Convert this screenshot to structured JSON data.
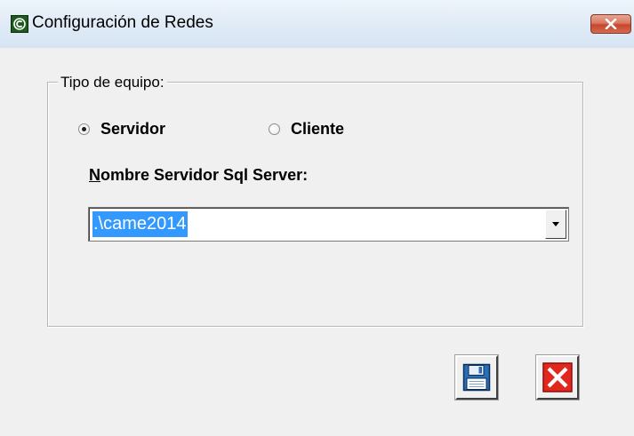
{
  "window": {
    "title": "Configuración de Redes",
    "app_icon": "c-logo-icon",
    "close_icon": "close-icon"
  },
  "group": {
    "legend": "Tipo de equipo:",
    "radios": [
      {
        "label": "Servidor",
        "checked": true
      },
      {
        "label": "Cliente",
        "checked": false
      }
    ],
    "server_label_mnemonic": "N",
    "server_label_rest": "ombre Servidor Sql Server:",
    "server_combo": {
      "value": ".\\came2014",
      "arrow_icon": "chevron-down-icon"
    }
  },
  "buttons": {
    "save_icon": "floppy-disk-icon",
    "cancel_icon": "red-x-icon"
  },
  "colors": {
    "selection": "#3399ff",
    "close_red": "#c7462c",
    "cancel_red": "#e0281e"
  }
}
